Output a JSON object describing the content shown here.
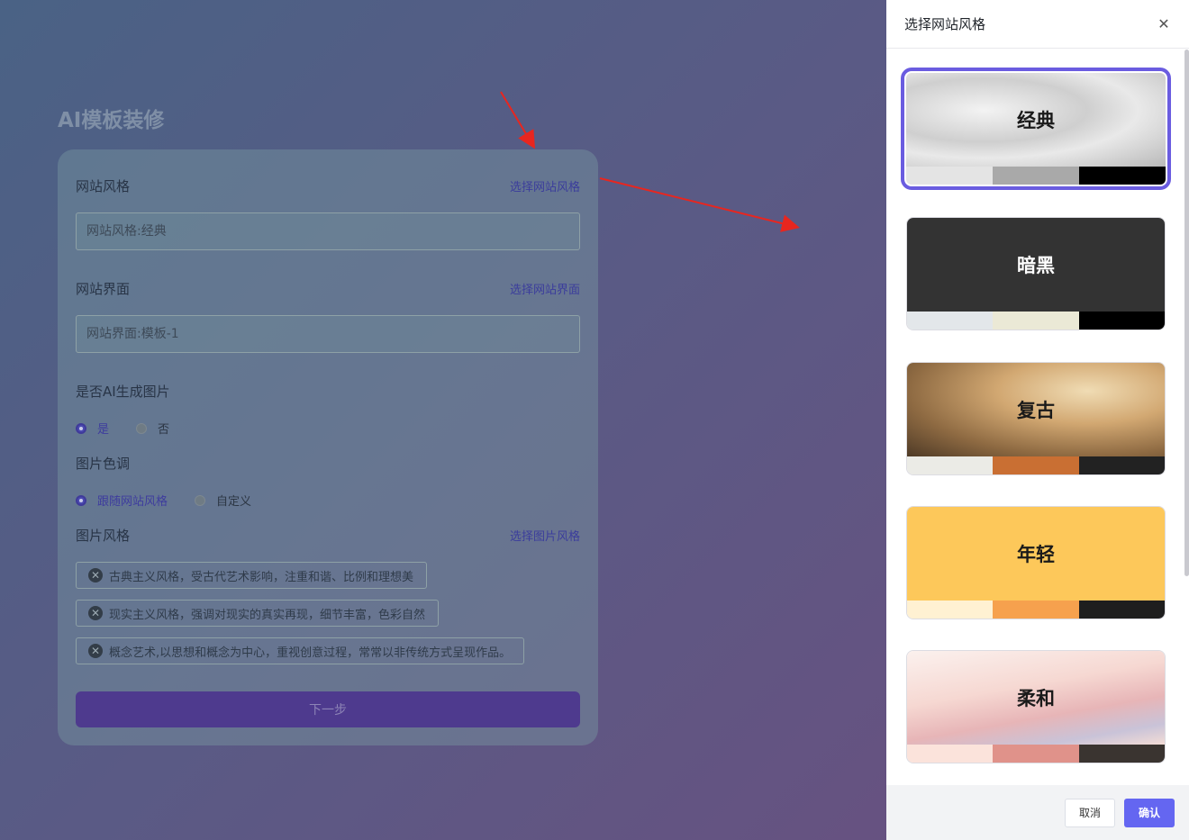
{
  "page": {
    "title": "AI模板装修"
  },
  "form": {
    "site_style": {
      "label": "网站风格",
      "link": "选择网站风格",
      "placeholder": "网站风格:经典"
    },
    "site_ui": {
      "label": "网站界面",
      "link": "选择网站界面",
      "placeholder": "网站界面:模板-1"
    },
    "ai_image": {
      "label": "是否AI生成图片",
      "options": [
        "是",
        "否"
      ],
      "selected": "是"
    },
    "image_tone": {
      "label": "图片色调",
      "options": [
        "跟随网站风格",
        "自定义"
      ],
      "selected": "跟随网站风格"
    },
    "image_style": {
      "label": "图片风格",
      "link": "选择图片风格",
      "tags": [
        "古典主义风格，受古代艺术影响，注重和谐、比例和理想美",
        "现实主义风格，强调对现实的真实再现，细节丰富，色彩自然",
        "概念艺术,以思想和概念为中心，重视创意过程，常常以非传统方式呈现作品。"
      ]
    },
    "next_label": "下一步"
  },
  "drawer": {
    "title": "选择网站风格",
    "close_icon": "close-icon",
    "styles": [
      {
        "name": "经典",
        "selected": true,
        "palette": [
          "#e4e4e4",
          "#a9a9a9",
          "#000000"
        ]
      },
      {
        "name": "暗黑",
        "selected": false,
        "palette": [
          "#e3e7ea",
          "#ebe9d6",
          "#000000"
        ]
      },
      {
        "name": "复古",
        "selected": false,
        "palette": [
          "#ebebe6",
          "#c96f33",
          "#222222"
        ]
      },
      {
        "name": "年轻",
        "selected": false,
        "palette": [
          "#fff1d2",
          "#f6a14e",
          "#1e1e1e"
        ]
      },
      {
        "name": "柔和",
        "selected": false,
        "palette": [
          "#fbe3db",
          "#e0928a",
          "#3a3430"
        ]
      }
    ],
    "cancel_label": "取消",
    "confirm_label": "确认"
  },
  "colors": {
    "accent": "#6466f1",
    "selected_border": "#6a5ce0",
    "annotation_arrow": "#e8261f"
  }
}
